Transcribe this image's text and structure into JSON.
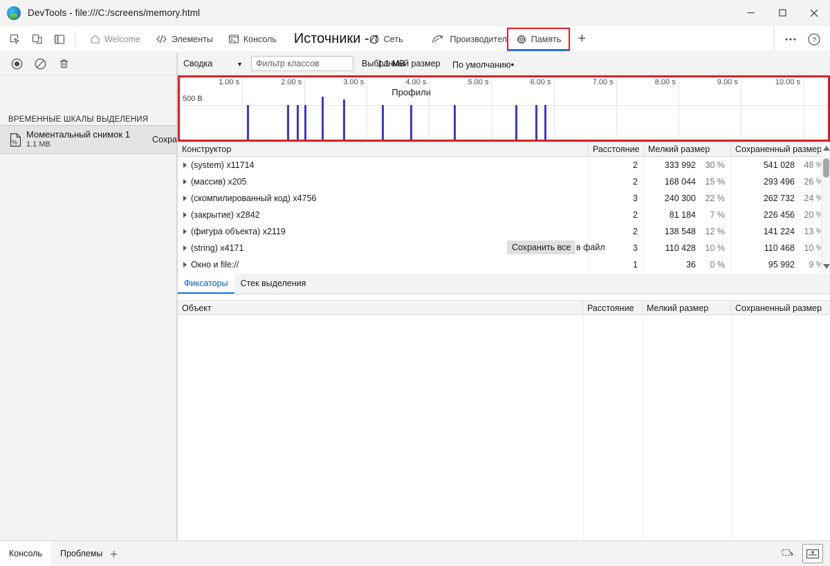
{
  "window": {
    "title": "DevTools - file:///C:/screens/memory.html",
    "logo_icon": "edge-devtools-logo",
    "minimize_label": "─",
    "maximize_label": "□",
    "close_label": "✕"
  },
  "navbar": {
    "tools": [
      {
        "name": "inspect-element-icon",
        "label": ""
      },
      {
        "name": "device-toolbar-icon",
        "label": ""
      },
      {
        "name": "dock-side-icon",
        "label": ""
      }
    ],
    "tabs": [
      {
        "label": "Welcome",
        "icon": "home-icon",
        "state": "muted"
      },
      {
        "label": "Элементы",
        "icon": "code-brackets-icon",
        "state": "normal"
      },
      {
        "label": "Консоль",
        "icon": "console-terminal-icon",
        "state": "normal"
      },
      {
        "label": "Источники -",
        "icon": "",
        "state": "big"
      },
      {
        "label": "Сеть",
        "icon": "network-icon",
        "state": "normal"
      },
      {
        "label": "Производительность",
        "icon": "performance-gauge-icon",
        "state": "normal"
      },
      {
        "label": "Память",
        "icon": "memory-chip-icon",
        "state": "selected"
      }
    ],
    "add_tab_label": "+",
    "more_label": "⋯",
    "help_label": "?",
    "selected_tab_highlight_color": "#e01b24",
    "selected_tab_underline_color": "#1a73e8"
  },
  "sidebar": {
    "toolbar": [
      {
        "name": "record-button",
        "label": ""
      },
      {
        "name": "clear-no-entry-button",
        "label": ""
      },
      {
        "name": "delete-trash-button",
        "label": ""
      }
    ],
    "section_title": "ВРЕМЕННЫЕ ШКАЛЫ ВЫДЕЛЕНИЯ",
    "snapshot": {
      "title": "Моментальный снимок 1",
      "size": "1.1 MB",
      "icon": "snapshot-percent-icon",
      "action_label": "Сохранить"
    }
  },
  "memory_toolbar": {
    "view_select": "Сводка",
    "filter_placeholder": "Фильтр классов",
    "selected_size_label": "Выбранный размер",
    "selected_size_value": "1.1 MB",
    "scope_label": "По умолчанию",
    "scope_dot": "•"
  },
  "chart_data": {
    "type": "bar",
    "title": "Профили",
    "xlabel": "",
    "ylabel": "500 B",
    "y_axis_label": "500 B",
    "grid": true,
    "xlim": [
      0,
      10.4
    ],
    "tick_labels": [
      "1.00 s",
      "2.00 s",
      "3.00 s",
      "4.00 s",
      "5.00 s",
      "6.00 s",
      "7.00 s",
      "8.00 s",
      "9.00 s",
      "10.00 s"
    ],
    "tick_values": [
      1,
      2,
      3,
      4,
      5,
      6,
      7,
      8,
      9,
      10
    ],
    "bar_color": "#3b36d6",
    "x": [
      1.08,
      1.72,
      1.88,
      2.0,
      2.28,
      2.62,
      3.24,
      3.7,
      4.4,
      5.38,
      5.7,
      5.85
    ],
    "values": [
      500,
      500,
      500,
      500,
      640,
      590,
      500,
      500,
      500,
      500,
      500,
      500
    ],
    "ylim": [
      0,
      760
    ]
  },
  "constructor_grid": {
    "columns": [
      "Конструктор",
      "Расстояние",
      "Мелкий размер",
      "Сохраненный размер"
    ],
    "rows": [
      {
        "name": "(system) x11714",
        "distance": "2",
        "shallow": "333 992",
        "shallow_pct": "30 %",
        "retained": "541 028",
        "retained_pct": "48 %"
      },
      {
        "name": "(массив) x205",
        "distance": "2",
        "shallow": "168 044",
        "shallow_pct": "15 %",
        "retained": "293 496",
        "retained_pct": "26 %"
      },
      {
        "name": "(скомпилированный код) x4756",
        "distance": "3",
        "shallow": "240 300",
        "shallow_pct": "22 %",
        "retained": "262 732",
        "retained_pct": "24 %"
      },
      {
        "name": "(закрытие) x2842",
        "distance": "2",
        "shallow": "81 184",
        "shallow_pct": "7 %",
        "retained": "226 456",
        "retained_pct": "20 %"
      },
      {
        "name": "(фигура объекта) x2119",
        "distance": "2",
        "shallow": "138 548",
        "shallow_pct": "12 %",
        "retained": "141 224",
        "retained_pct": "13 %"
      },
      {
        "name": "(string) x4171",
        "distance": "3",
        "shallow": "110 428",
        "shallow_pct": "10 %",
        "retained": "110 468",
        "retained_pct": "10 %"
      },
      {
        "name": "Окно и file://",
        "distance": "1",
        "shallow": "36",
        "shallow_pct": "0 %",
        "retained": "95 992",
        "retained_pct": "9 %"
      }
    ],
    "save_all_button": "Сохранить все",
    "save_all_tail": "в файл"
  },
  "sub_panel": {
    "tabs": [
      {
        "label": "Фиксаторы",
        "active": true
      },
      {
        "label": "Стек выделения",
        "active": false
      }
    ],
    "columns": [
      "Объект",
      "Расстояние",
      "Мелкий размер",
      "Сохраненный размер"
    ],
    "rows": []
  },
  "drawer": {
    "tabs": [
      {
        "label": "Консоль",
        "active": true
      },
      {
        "label": "Проблемы",
        "active": false
      }
    ],
    "add_label": "+",
    "right_buttons": [
      {
        "name": "screencast-icon",
        "label": ""
      },
      {
        "name": "dock-bottom-icon",
        "label": ""
      }
    ]
  }
}
